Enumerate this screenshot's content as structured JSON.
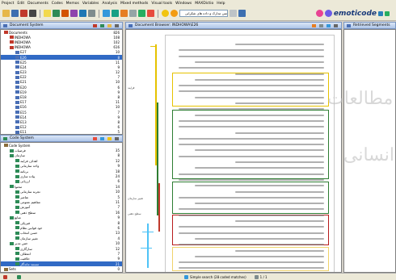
{
  "menu": [
    "Project",
    "Edit",
    "Documents",
    "Codes",
    "Memos",
    "Variables",
    "Analysis",
    "Mixed methods",
    "Visual tools",
    "Windows",
    "MAXDictio",
    "Help"
  ],
  "toolbar": {
    "search_text": "متن مدارک و داده های شکرانی",
    "brand": "emoticode"
  },
  "document_system": {
    "title": "Document System",
    "col_name": "",
    "col_count": "",
    "rows": [
      {
        "label": "Documents",
        "count": "826",
        "level": 0,
        "color": "#c0392b"
      },
      {
        "label": "INDHOWA",
        "count": "108",
        "level": 1,
        "color": "#c0392b"
      },
      {
        "label": "INDHOWA",
        "count": "102",
        "level": 1,
        "color": "#c0392b"
      },
      {
        "label": "INDHOWA",
        "count": "616",
        "level": 1,
        "color": "#c0392b"
      },
      {
        "label": "E27",
        "count": "10",
        "level": 2,
        "color": "#4a6fb5"
      },
      {
        "label": "E26",
        "count": "8",
        "level": 2,
        "color": "#4a6fb5"
      },
      {
        "label": "E25",
        "count": "11",
        "level": 2,
        "color": "#4a6fb5"
      },
      {
        "label": "E24",
        "count": "9",
        "level": 2,
        "color": "#4a6fb5"
      },
      {
        "label": "E23",
        "count": "12",
        "level": 2,
        "color": "#4a6fb5"
      },
      {
        "label": "E22",
        "count": "7",
        "level": 2,
        "color": "#4a6fb5"
      },
      {
        "label": "E21",
        "count": "10",
        "level": 2,
        "color": "#4a6fb5"
      },
      {
        "label": "E20",
        "count": "6",
        "level": 2,
        "color": "#4a6fb5"
      },
      {
        "label": "E19",
        "count": "9",
        "level": 2,
        "color": "#4a6fb5"
      },
      {
        "label": "E18",
        "count": "8",
        "level": 2,
        "color": "#4a6fb5"
      },
      {
        "label": "E17",
        "count": "11",
        "level": 2,
        "color": "#4a6fb5"
      },
      {
        "label": "E16",
        "count": "10",
        "level": 2,
        "color": "#4a6fb5"
      },
      {
        "label": "E15",
        "count": "7",
        "level": 2,
        "color": "#4a6fb5"
      },
      {
        "label": "E14",
        "count": "9",
        "level": 2,
        "color": "#4a6fb5"
      },
      {
        "label": "E13",
        "count": "8",
        "level": 2,
        "color": "#4a6fb5"
      },
      {
        "label": "E12",
        "count": "6",
        "level": 2,
        "color": "#4a6fb5"
      },
      {
        "label": "E11",
        "count": "5",
        "level": 2,
        "color": "#4a6fb5"
      }
    ],
    "selected_index": 5
  },
  "code_system": {
    "title": "Code System",
    "rows": [
      {
        "label": "Code System",
        "count": "",
        "level": 0,
        "color": "#8a6d3b"
      },
      {
        "label": "فرضیات",
        "count": "35",
        "level": 1,
        "color": "#2e8b57"
      },
      {
        "label": "سازمان",
        "count": "8",
        "level": 1,
        "color": "#2e8b57"
      },
      {
        "label": "اهداف فرایند",
        "count": "12",
        "level": 2,
        "color": "#2e8b57"
      },
      {
        "label": "واحد سازمانی",
        "count": "9",
        "level": 2,
        "color": "#2e8b57"
      },
      {
        "label": "برنامه",
        "count": "18",
        "level": 2,
        "color": "#2e8b57"
      },
      {
        "label": "پیاده سازی",
        "count": "24",
        "level": 2,
        "color": "#2e8b57"
      },
      {
        "label": "ارزیابی",
        "count": "6",
        "level": 2,
        "color": "#2e8b57"
      },
      {
        "label": "محتوا",
        "count": "14",
        "level": 1,
        "color": "#2e8b57"
      },
      {
        "label": "تجربه سازمانی",
        "count": "10",
        "level": 2,
        "color": "#2e8b57"
      },
      {
        "label": "عناصر",
        "count": "5",
        "level": 2,
        "color": "#2e8b57"
      },
      {
        "label": "مفاهیم عمومی",
        "count": "11",
        "level": 2,
        "color": "#2e8b57"
      },
      {
        "label": "آموزش",
        "count": "7",
        "level": 2,
        "color": "#2e8b57"
      },
      {
        "label": "سطح ذهنی",
        "count": "16",
        "level": 2,
        "color": "#2e8b57"
      },
      {
        "label": "منابع",
        "count": "9",
        "level": 1,
        "color": "#2e8b57"
      },
      {
        "label": "فیزیکی",
        "count": "8",
        "level": 2,
        "color": "#2e8b57"
      },
      {
        "label": "خود قوانین نظام",
        "count": "6",
        "level": 2,
        "color": "#2e8b57"
      },
      {
        "label": "حسن انتخاب",
        "count": "13",
        "level": 2,
        "color": "#2e8b57"
      },
      {
        "label": "تغییر سازمان",
        "count": "4",
        "level": 2,
        "color": "#2e8b57"
      },
      {
        "label": "حس مدیر",
        "count": "10",
        "level": 1,
        "color": "#2e8b57"
      },
      {
        "label": "سازگاری",
        "count": "12",
        "level": 2,
        "color": "#2e8b57"
      },
      {
        "label": "انعطاف",
        "count": "7",
        "level": 2,
        "color": "#2e8b57"
      },
      {
        "label": "خلاقیت",
        "count": "9",
        "level": 2,
        "color": "#2e8b57"
      },
      {
        "label": "مستند ماندگار",
        "count": "21",
        "level": 2,
        "color": "#2e8b57"
      },
      {
        "label": "Sets",
        "count": "0",
        "level": 0,
        "color": "#8a6d3b"
      }
    ],
    "selected_index": 23
  },
  "document_browser": {
    "title": "Document Browser: INDHOWA\\E26",
    "gutter_labels": [
      "فرایند",
      "تغییر سازمان",
      "سطح ذهنی",
      "مستند"
    ]
  },
  "retrieved": {
    "title": "Retrieved Segments"
  },
  "watermark": {
    "line1": "مطالعات",
    "line2": "انسانی"
  },
  "statusbar": {
    "items": [
      "",
      "",
      "Simple search (28 coded matches)",
      "1 / 1"
    ]
  }
}
